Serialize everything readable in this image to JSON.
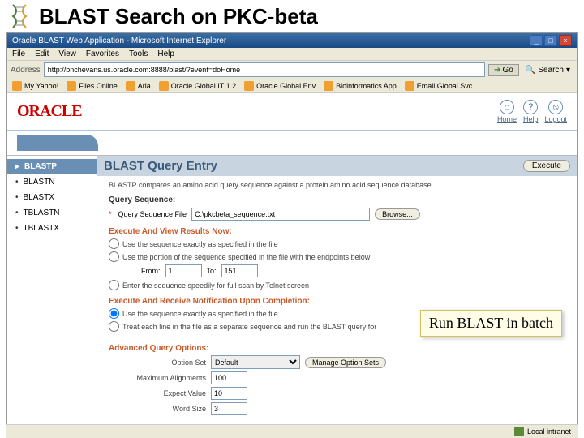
{
  "slide": {
    "title": "BLAST Search on PKC-beta"
  },
  "window": {
    "title": "Oracle BLAST Web Application - Microsoft Internet Explorer"
  },
  "menu": {
    "file": "File",
    "edit": "Edit",
    "view": "View",
    "favorites": "Favorites",
    "tools": "Tools",
    "help": "Help"
  },
  "address": {
    "label": "Address",
    "value": "http://bnchevans.us.oracle.com:8888/blast/?event=doHome",
    "go": "Go",
    "search": "Search"
  },
  "linksbar": {
    "my_yahoo": "My Yahoo!",
    "files": "Files Online",
    "aria": "Aria",
    "oracle2": "Oracle Global IT 1.2",
    "oracle3": "Oracle Global Env",
    "bio": "Bioinformatics App",
    "email": "Email  Global Svc"
  },
  "oracle": {
    "logo": "ORACLE"
  },
  "header_links": {
    "home": "Home",
    "help": "Help",
    "logout": "Logout"
  },
  "sidebar": {
    "items": [
      {
        "label": "BLASTP",
        "active": true
      },
      {
        "label": "BLASTN",
        "active": false
      },
      {
        "label": "BLASTX",
        "active": false
      },
      {
        "label": "TBLASTN",
        "active": false
      },
      {
        "label": "TBLASTX",
        "active": false
      }
    ]
  },
  "panel": {
    "title": "BLAST Query Entry",
    "execute": "Execute",
    "desc": "BLASTP compares an amino acid query sequence against a protein amino acid sequence database.",
    "query_seq_label": "Query Sequence:",
    "query_seq_field_label": "Query Sequence File",
    "query_seq_value": "C:\\pkcbeta_sequence.txt",
    "browse": "Browse...",
    "exec_now": "Execute And View Results Now:",
    "radio1": "Use the sequence exactly as specified in the file",
    "radio2": "Use the portion of the sequence specified in the file with the endpoints below:",
    "from": "From:",
    "from_val": "1",
    "to": "To:",
    "to_val": "151",
    "radio3": "Enter the sequence speedily for full scan by Telnet screen",
    "exec_batch": "Execute And Receive Notification Upon Completion:",
    "radio4": "Use the sequence exactly as specified in the file",
    "radio5": "Treat each line in the file as a separate sequence and run the BLAST query for",
    "adv": "Advanced Query Options:",
    "option_set": "Option Set",
    "option_set_val": "Default",
    "manage": "Manage Option Sets",
    "max_align": "Maximum Alignments",
    "max_align_val": "100",
    "expect": "Expect Value",
    "expect_val": "10",
    "word": "Word Size",
    "word_val": "3"
  },
  "callout": {
    "text": "Run BLAST in batch"
  },
  "status": {
    "zone": "Local intranet"
  }
}
